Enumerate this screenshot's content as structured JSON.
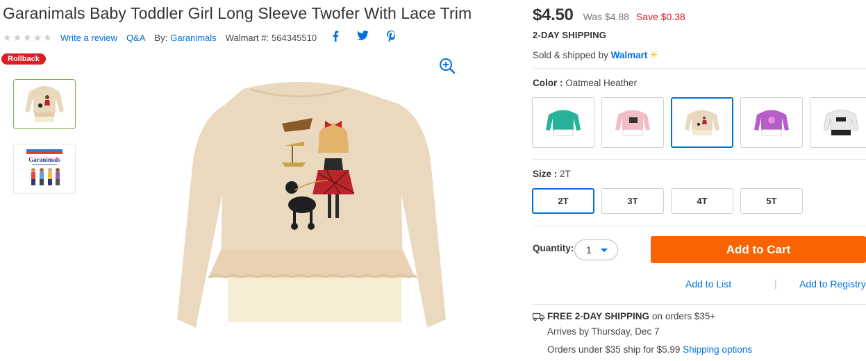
{
  "product": {
    "title": "Garanimals Baby Toddler Girl Long Sleeve Twofer With Lace Trim",
    "rating_stars": 0,
    "write_review": "Write a review",
    "qa": "Q&A",
    "by_label": "By:",
    "brand": "Garanimals",
    "walmart_num_label": "Walmart #:",
    "walmart_num": "564345510",
    "rollback": "Rollback",
    "thumb2_brand": "Garanimals"
  },
  "social": {
    "facebook": "f",
    "twitter": "t",
    "pinterest": "p"
  },
  "pricing": {
    "price": "$4.50",
    "was": "Was $4.88",
    "save": "Save $0.38",
    "shipping_head": "2-DAY SHIPPING",
    "sold_by_prefix": "Sold & shipped by",
    "seller": "Walmart"
  },
  "color": {
    "label": "Color :",
    "value": "Oatmeal Heather",
    "swatches": [
      "Teal",
      "Pink",
      "Oatmeal Heather",
      "Purple",
      "White"
    ],
    "swatch_colors": [
      "#27b39a",
      "#f4bcc6",
      "#e8d8bf",
      "#b65fc6",
      "#e9e9e9"
    ]
  },
  "size": {
    "label": "Size :",
    "value": "2T",
    "options": [
      "2T",
      "3T",
      "4T",
      "5T"
    ]
  },
  "purchase": {
    "qty_label": "Quantity:",
    "qty_value": "1",
    "add_to_cart": "Add to Cart",
    "add_to_list": "Add to List",
    "separator": "|",
    "add_to_registry": "Add to Registry"
  },
  "shipping": {
    "free_bold": "FREE 2-DAY SHIPPING",
    "free_rest": "on orders $35+",
    "arrives": "Arrives by Thursday, Dec 7",
    "orders_under": "Orders under $35 ship for $5.99",
    "options_link": "Shipping options"
  },
  "colors": {
    "link": "#0071dc",
    "sale": "#de1c24",
    "cart": "#f96302",
    "spark": "#ffc220"
  }
}
